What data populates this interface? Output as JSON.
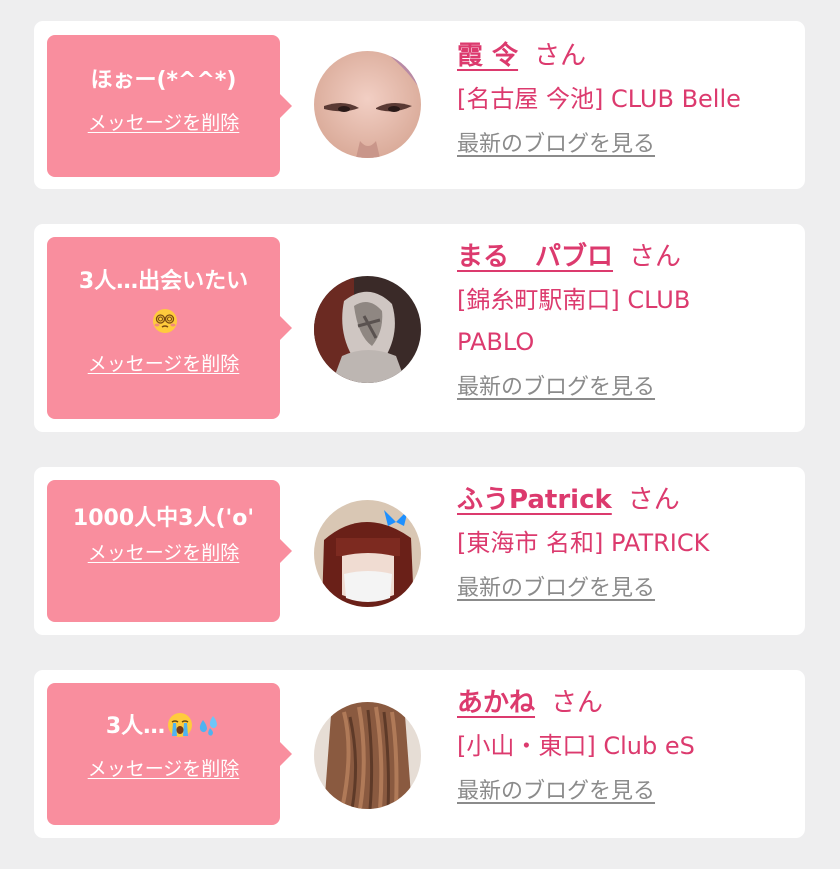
{
  "entries": [
    {
      "message": "ほぉー(*^^*)",
      "message_emoji": "",
      "delete_label": "メッセージを削除",
      "name": "霞 令",
      "honorific": "さん",
      "shop": "[名古屋 今池] CLUB Belle",
      "blog_link": "最新のブログを見る"
    },
    {
      "message": "3人…出会いたい",
      "message_emoji": "dizzy-face-emoji",
      "delete_label": "メッセージを削除",
      "name": "まる　パブロ",
      "honorific": "さん",
      "shop": "[錦糸町駅南口] CLUB PABLO",
      "blog_link": "最新のブログを見る"
    },
    {
      "message": "1000人中3人('o'",
      "message_emoji": "",
      "delete_label": "メッセージを削除",
      "name": "ふうPatrick",
      "honorific": "さん",
      "shop": "[東海市 名和] PATRICK",
      "blog_link": "最新のブログを見る"
    },
    {
      "message": "3人…",
      "message_emoji": "crying-face-and-sweat-droplets-emoji",
      "delete_label": "メッセージを削除",
      "name": "あかね",
      "honorific": "さん",
      "shop": "[小山・東口] Club eS",
      "blog_link": "最新のブログを見る"
    }
  ],
  "colors": {
    "background": "#eeeeef",
    "card": "#ffffff",
    "bubble": "#f98e9e",
    "accent_text": "#dc3a6e",
    "link_gray": "#8b8b8b"
  }
}
